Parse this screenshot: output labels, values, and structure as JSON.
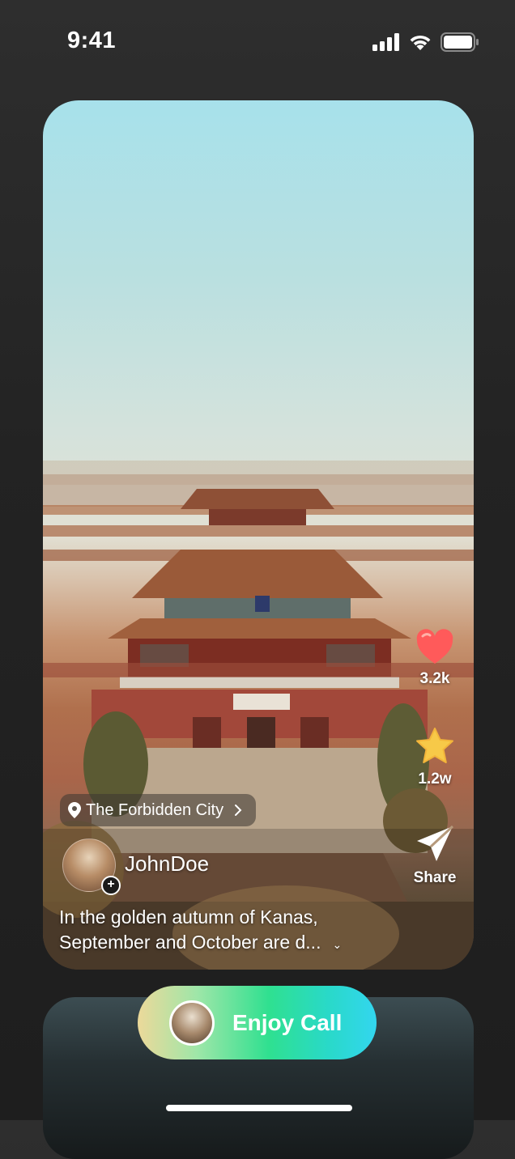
{
  "status_bar": {
    "time": "9:41"
  },
  "post": {
    "location": "The Forbidden City",
    "username": "JohnDoe",
    "caption_line1": "In the golden autumn of Kanas,",
    "caption_line2": "September and October are d..."
  },
  "actions": {
    "like_count": "3.2k",
    "favorite_count": "1.2w",
    "share_label": "Share"
  },
  "call": {
    "label": "Enjoy Call"
  },
  "icons": [
    "signal-icon",
    "wifi-icon",
    "battery-icon",
    "heart-icon",
    "star-icon",
    "share-icon",
    "location-pin-icon",
    "chevron-right-icon",
    "chevron-down-icon",
    "plus-icon"
  ],
  "colors": {
    "like": "#ff5a5a",
    "star": "#f7c948",
    "call_gradient_start": "#ecd99a",
    "call_gradient_end": "#33d6ef"
  }
}
